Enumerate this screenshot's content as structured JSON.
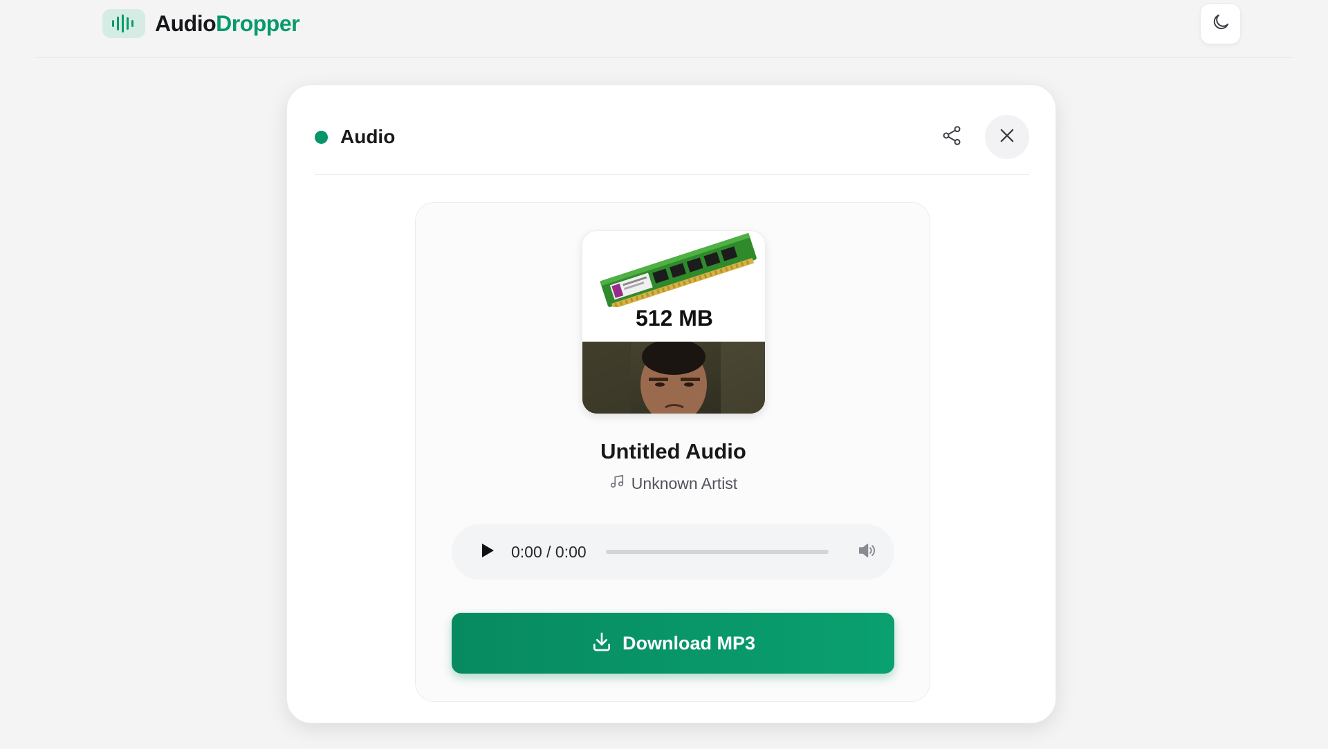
{
  "header": {
    "brand_first": "Audio",
    "brand_second": "Dropper",
    "theme_toggle_icon": "moon-icon"
  },
  "card": {
    "title": "Audio",
    "status_color": "#07956a",
    "share_icon": "share-icon",
    "close_icon": "close-icon"
  },
  "artwork": {
    "caption": "512 MB"
  },
  "track": {
    "title": "Untitled Audio",
    "artist": "Unknown Artist"
  },
  "player": {
    "time": "0:00 / 0:00",
    "progress": 0
  },
  "download": {
    "label": "Download MP3",
    "color": "#079a6b"
  }
}
